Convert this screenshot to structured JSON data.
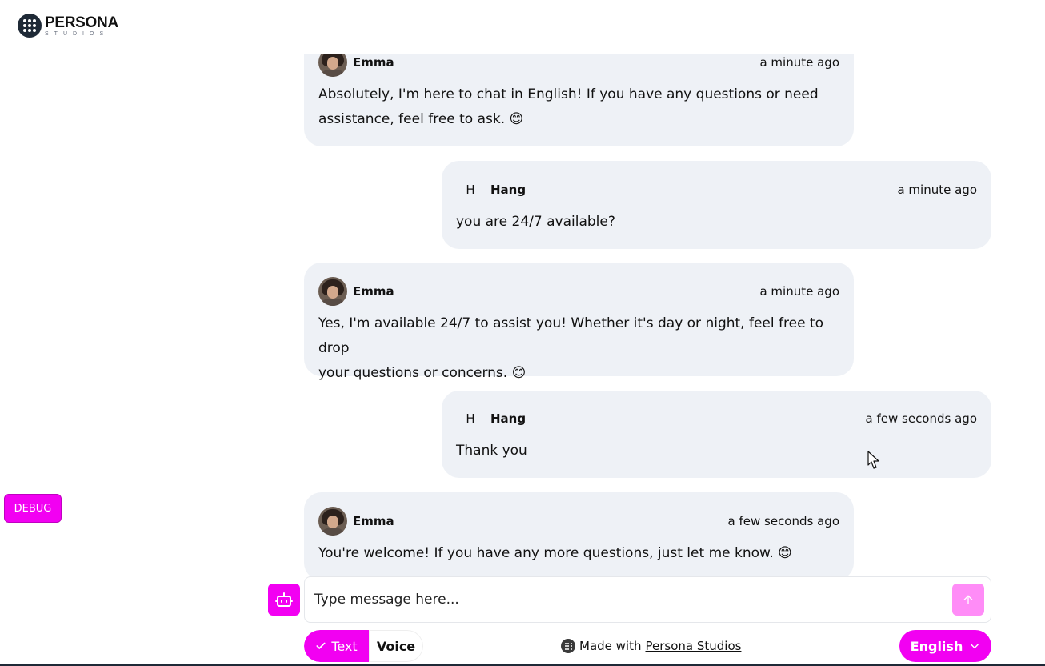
{
  "brand": {
    "title": "PERSONA",
    "subtitle": "STUDIOS"
  },
  "messages": [
    {
      "role": "bot",
      "name": "Emma",
      "time": "a minute ago",
      "lines": [
        "Absolutely, I'm here to chat in English! If you have any questions or need",
        "assistance, feel free to ask. 😊"
      ]
    },
    {
      "role": "user",
      "initial": "H",
      "name": "Hang",
      "time": "a minute ago",
      "lines": [
        "you are 24/7 available?"
      ]
    },
    {
      "role": "bot",
      "name": "Emma",
      "time": "a minute ago",
      "lines": [
        "Yes, I'm available 24/7 to assist you! Whether it's day or night, feel free to drop",
        "your questions or concerns. 😊"
      ]
    },
    {
      "role": "user",
      "initial": "H",
      "name": "Hang",
      "time": "a few seconds ago",
      "lines": [
        "Thank you"
      ]
    },
    {
      "role": "bot",
      "name": "Emma",
      "time": "a few seconds ago",
      "lines": [
        "You're welcome! If you have any more questions, just let me know. 😊"
      ]
    }
  ],
  "debug_label": "DEBUG",
  "composer": {
    "placeholder": "Type message here..."
  },
  "mode": {
    "text_label": "Text",
    "voice_label": "Voice"
  },
  "footer": {
    "made_with": "Made with",
    "link": "Persona Studios"
  },
  "language": {
    "selected": "English"
  },
  "colors": {
    "accent": "#f200f2",
    "send_disabled": "#ff8cf7",
    "bubble": "#eef1f6"
  },
  "icons": {
    "bot": "robot-icon",
    "send": "arrow-up-icon",
    "check": "check-icon",
    "chevron": "chevron-down-icon"
  }
}
